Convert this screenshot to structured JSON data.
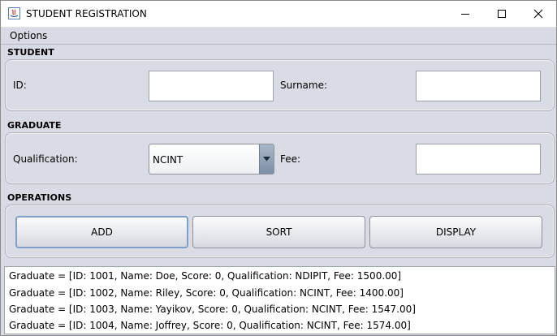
{
  "window": {
    "title": "STUDENT REGISTRATION",
    "minimize_icon": "minimize-icon",
    "maximize_icon": "maximize-icon",
    "close_icon": "close-icon"
  },
  "menu": {
    "items": [
      "Options"
    ]
  },
  "student": {
    "section_title": "STUDENT",
    "id_label": "ID:",
    "id_value": "",
    "surname_label": "Surname:",
    "surname_value": ""
  },
  "graduate": {
    "section_title": "GRADUATE",
    "qualification_label": "Qualification:",
    "qualification_value": "NCINT",
    "fee_label": "Fee:",
    "fee_value": ""
  },
  "operations": {
    "section_title": "OPERATIONS",
    "add_label": "ADD",
    "sort_label": "SORT",
    "display_label": "DISPLAY"
  },
  "output": {
    "lines": [
      "Graduate = [ID: 1001, Name: Doe, Score: 0, Qualification: NDIPIT, Fee: 1500.00]",
      "Graduate = [ID: 1002, Name: Riley, Score: 0, Qualification: NCINT, Fee: 1400.00]",
      "Graduate = [ID: 1003, Name: Yayikov, Score: 0, Qualification: NCINT, Fee: 1547.00]",
      "Graduate = [ID: 1004, Name: Joffrey, Score: 0, Qualification: NCINT, Fee: 1574.00]"
    ]
  },
  "colors": {
    "window_bg": "#d8dbe3",
    "focus_border": "#7f9ec8",
    "combo_arrow": "#7d8fa8"
  }
}
